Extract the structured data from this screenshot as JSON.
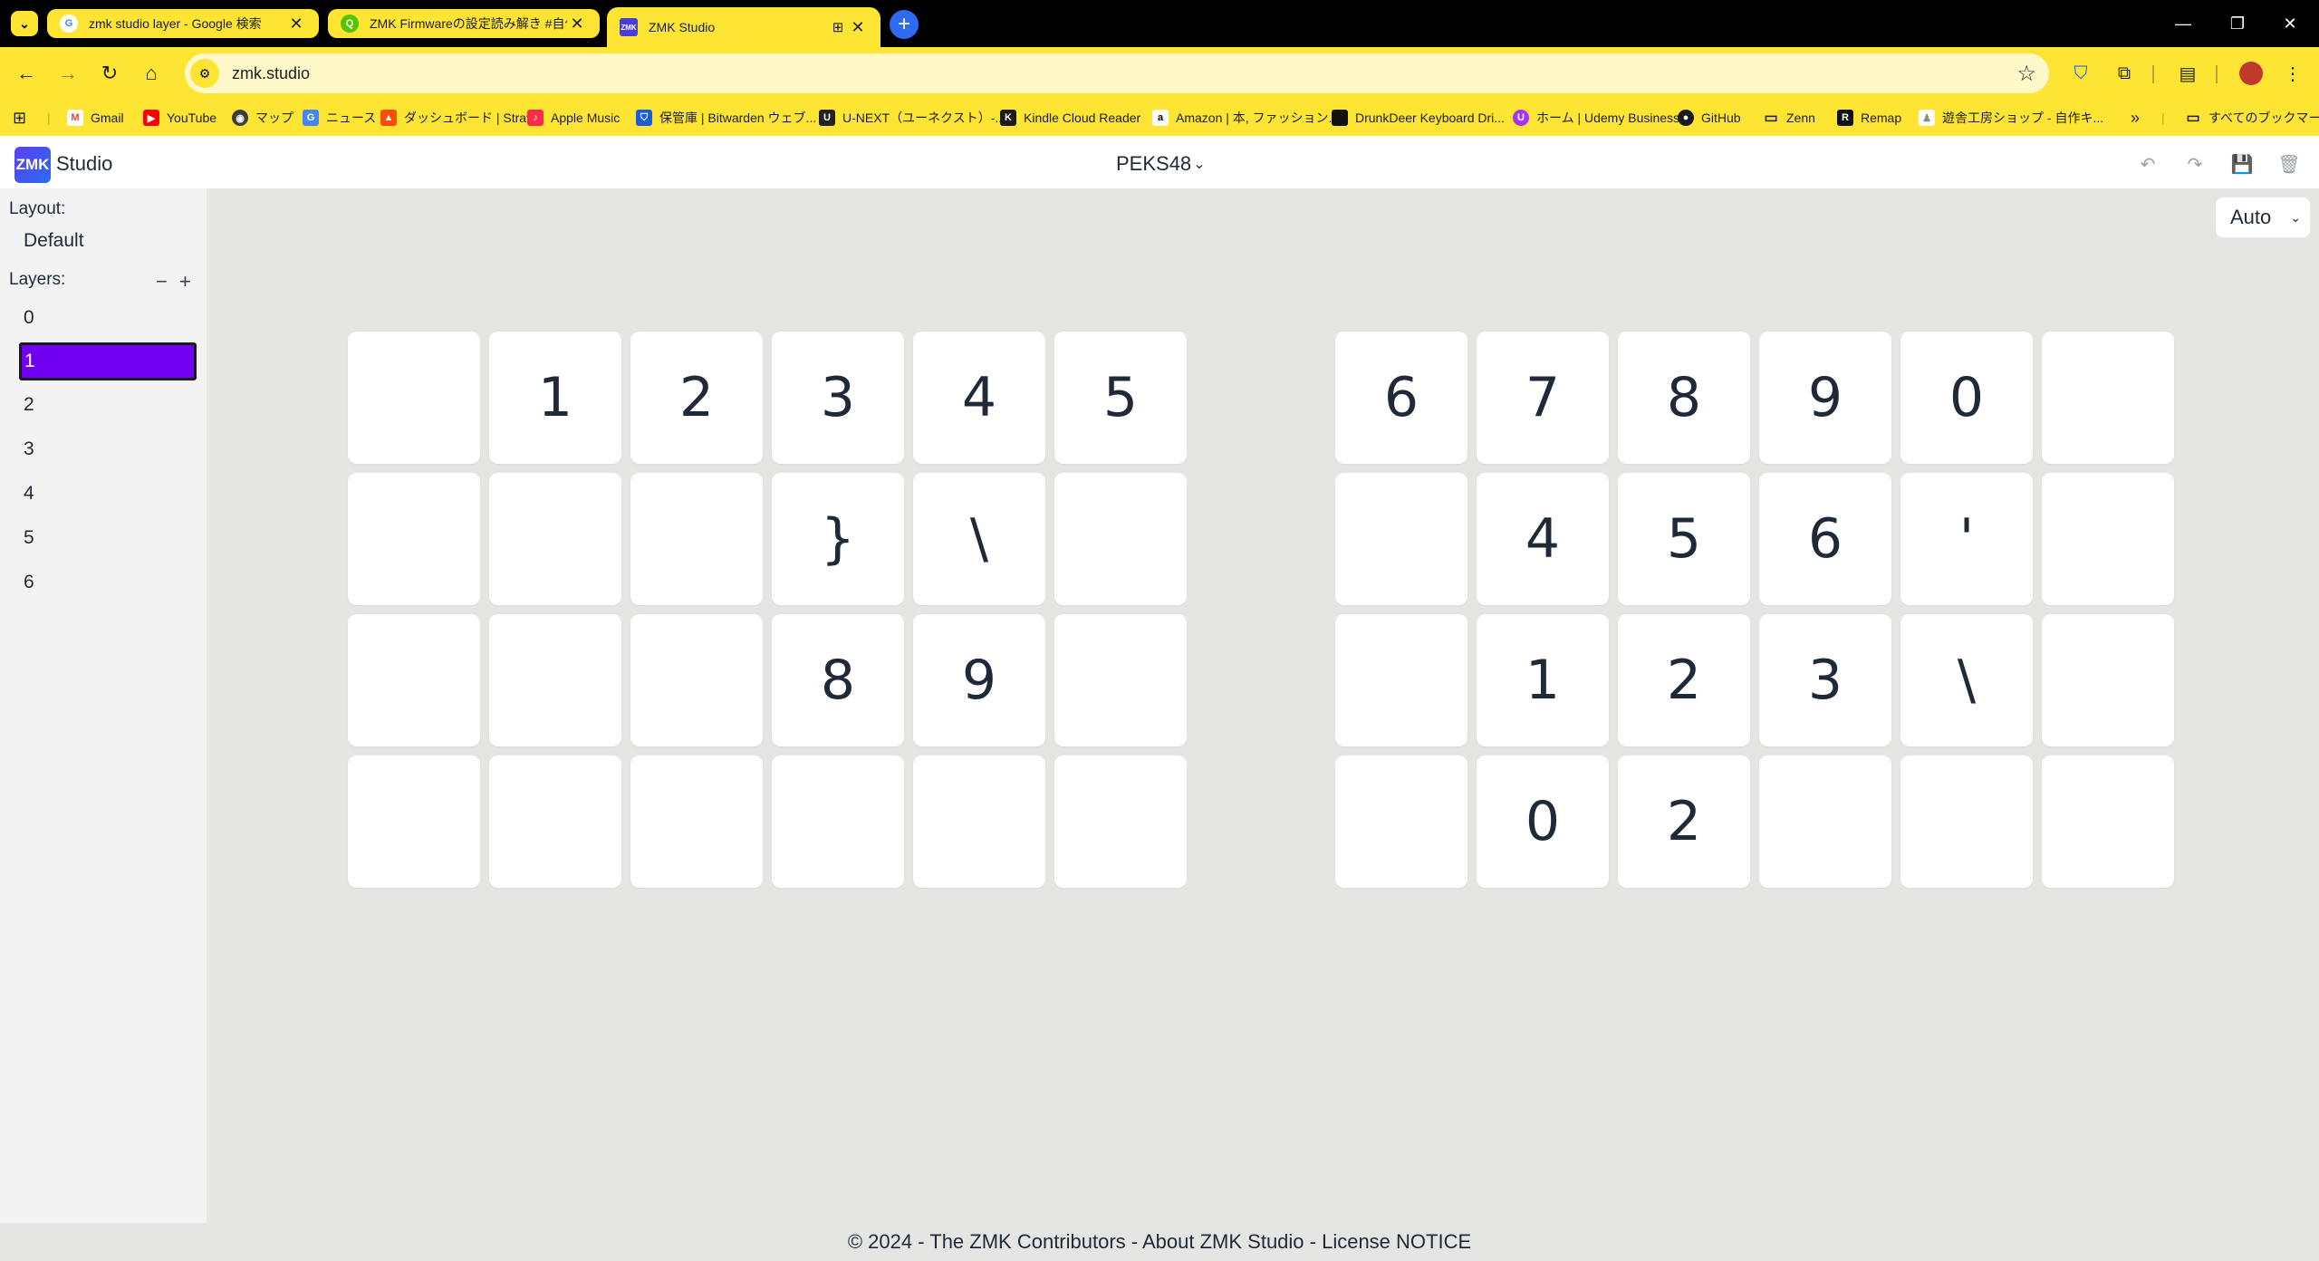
{
  "browser": {
    "tabs": [
      {
        "title": "zmk studio layer - Google 検索",
        "favicon": "google-icon",
        "active": false
      },
      {
        "title": "ZMK Firmwareの設定読み解き #自作キ",
        "favicon": "qiita-icon",
        "active": false
      },
      {
        "title": "ZMK Studio",
        "favicon": "zmk-icon",
        "active": true
      }
    ],
    "url": "zmk.studio",
    "bookmarks": [
      {
        "label": "Gmail",
        "icon": "gmail-icon"
      },
      {
        "label": "YouTube",
        "icon": "youtube-icon"
      },
      {
        "label": "マップ",
        "icon": "maps-icon"
      },
      {
        "label": "ニュース",
        "icon": "news-icon"
      },
      {
        "label": "ダッシュボード | Strava",
        "icon": "strava-icon"
      },
      {
        "label": "Apple Music",
        "icon": "apple-music-icon"
      },
      {
        "label": "保管庫 | Bitwarden ウェブ...",
        "icon": "bitwarden-icon"
      },
      {
        "label": "U-NEXT（ユーネクスト）-...",
        "icon": "unext-icon"
      },
      {
        "label": "Kindle Cloud Reader",
        "icon": "kindle-icon"
      },
      {
        "label": "Amazon | 本, ファッション...",
        "icon": "amazon-icon"
      },
      {
        "label": "DrunkDeer Keyboard Dri...",
        "icon": "drunkdeer-icon"
      },
      {
        "label": "ホーム | Udemy Business",
        "icon": "udemy-icon"
      },
      {
        "label": "GitHub",
        "icon": "github-icon"
      },
      {
        "label": "Zenn",
        "icon": "folder-icon"
      },
      {
        "label": "Remap",
        "icon": "remap-icon"
      },
      {
        "label": "遊舎工房ショップ - 自作キ...",
        "icon": "yusha-icon"
      }
    ],
    "all_bookmarks_label": "すべてのブックマーク"
  },
  "app": {
    "logo_badge": "ZMK",
    "logo_text": "Studio",
    "keyboard_name": "PEKS48",
    "layout_label": "Layout:",
    "layout_value": "Default",
    "layers_label": "Layers:",
    "layers": [
      "0",
      "1",
      "2",
      "3",
      "4",
      "5",
      "6"
    ],
    "selected_layer": "1",
    "zoom_select": "Auto",
    "footer": "© 2024 - The ZMK Contributors - About ZMK Studio - License NOTICE"
  },
  "keymap": {
    "left": [
      [
        "",
        "1",
        "2",
        "3",
        "4",
        "5"
      ],
      [
        "",
        "",
        "",
        "}",
        "\\",
        ""
      ],
      [
        "",
        "",
        "",
        "8",
        "9",
        ""
      ],
      [
        "",
        "",
        "",
        "",
        "",
        ""
      ]
    ],
    "right": [
      [
        "6",
        "7",
        "8",
        "9",
        "0",
        ""
      ],
      [
        "",
        "4",
        "5",
        "6",
        "'",
        ""
      ],
      [
        "",
        "1",
        "2",
        "3",
        "\\",
        ""
      ],
      [
        "",
        "0",
        "2",
        "",
        "",
        ""
      ]
    ]
  }
}
